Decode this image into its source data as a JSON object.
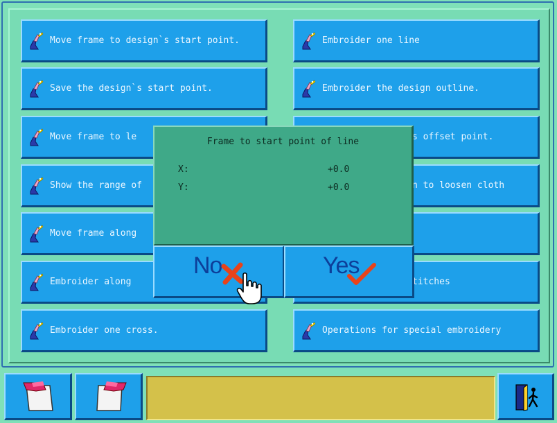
{
  "menu": {
    "left": [
      {
        "label": "Move frame to design`s start point."
      },
      {
        "label": "Save the design`s start point."
      },
      {
        "label": "Move frame to le"
      },
      {
        "label": "Show the range of"
      },
      {
        "label": "Move frame along"
      },
      {
        "label": "Embroider along"
      },
      {
        "label": "Embroider one cross."
      }
    ],
    "right": [
      {
        "label": "Embroider one line"
      },
      {
        "label": "Embroider the design outline."
      },
      {
        "label": "s offset point."
      },
      {
        "label": "n to loosen cloth"
      },
      {
        "label": ""
      },
      {
        "label": "titches"
      },
      {
        "label": "Operations for special embroidery"
      }
    ]
  },
  "dialog": {
    "title": "Frame to start point of line",
    "x_label": "X:",
    "x_value": "+0.0",
    "y_label": "Y:",
    "y_value": "+0.0",
    "no_label": "No",
    "yes_label": "Yes"
  },
  "status": {
    "text": ""
  },
  "colors": {
    "background": "#7fe0b8",
    "button": "#1ea0ea",
    "dialog": "#3fa988",
    "status_field": "#d4c14a",
    "cross": "#e8431a"
  },
  "icons": {
    "menu_item": "needle-hand-icon",
    "bar_left_1": "page-with-hand-icon",
    "bar_left_2": "page-with-hand-icon",
    "exit": "exit-door-icon",
    "no": "cross-icon",
    "yes": "check-icon",
    "pointer": "hand-pointer-icon"
  }
}
